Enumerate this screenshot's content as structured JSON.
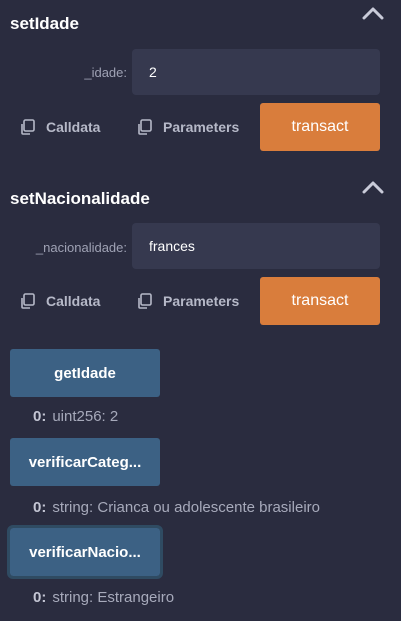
{
  "colors": {
    "background": "#2a2c3f",
    "input_bg": "#36394f",
    "transact_bg": "#d97d3c",
    "call_bg": "#3c6184"
  },
  "sections": [
    {
      "title": "setIdade",
      "param_label": "_idade:",
      "param_value": "2",
      "calldata_label": "Calldata",
      "parameters_label": "Parameters",
      "transact_label": "transact",
      "collapse_icon": "chevron-up-icon"
    },
    {
      "title": "setNacionalidade",
      "param_label": "_nacionalidade:",
      "param_value": "frances",
      "calldata_label": "Calldata",
      "parameters_label": "Parameters",
      "transact_label": "transact",
      "collapse_icon": "chevron-up-icon"
    }
  ],
  "calls": [
    {
      "button_label": "getIdade",
      "result_index": "0:",
      "result_text": "uint256: 2"
    },
    {
      "button_label": "verificarCateg...",
      "result_index": "0:",
      "result_text": "string: Crianca ou adolescente brasileiro"
    },
    {
      "button_label": "verificarNacio...",
      "result_index": "0:",
      "result_text": "string: Estrangeiro"
    }
  ]
}
